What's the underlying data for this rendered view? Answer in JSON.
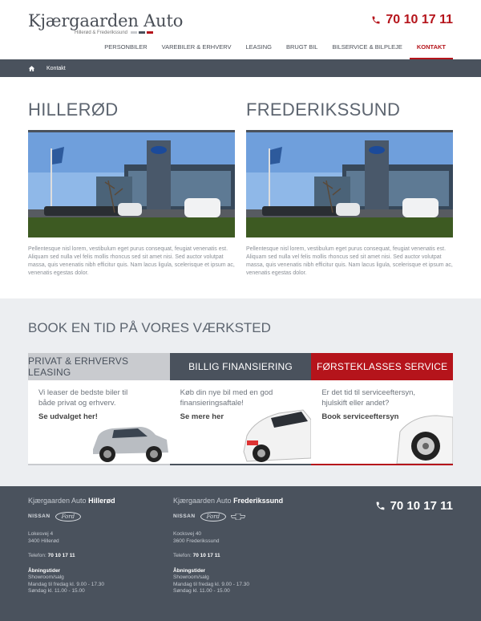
{
  "header": {
    "logo_title": "Kjærgaarden Auto",
    "logo_subtitle": "Hillerød & Frederikssund",
    "phone": "70 10 17 11",
    "nav": [
      {
        "label": "PERSONBILER",
        "active": false
      },
      {
        "label": "VAREBILER & ERHVERV",
        "active": false
      },
      {
        "label": "LEASING",
        "active": false
      },
      {
        "label": "BRUGT BIL",
        "active": false
      },
      {
        "label": "BILSERVICE & BILPLEJE",
        "active": false
      },
      {
        "label": "KONTAKT",
        "active": true
      }
    ]
  },
  "breadcrumb": {
    "current": "Kontakt"
  },
  "locations": [
    {
      "title": "HILLERØD",
      "text": "Pellentesque nisl lorem, vestibulum eget purus consequat, feugiat venenatis est. Aliquam sed nulla vel felis mollis rhoncus sed sit amet nisi. Sed auctor volutpat massa, quis venenatis nibh efficitur quis. Nam lacus ligula, scelerisque et ipsum ac, venenatis egestas dolor."
    },
    {
      "title": "FREDERIKSSUND",
      "text": "Pellentesque nisl lorem, vestibulum eget purus consequat, feugiat venenatis est. Aliquam sed nulla vel felis mollis rhoncus sed sit amet nisi. Sed auctor volutpat massa, quis venenatis nibh efficitur quis. Nam lacus ligula, scelerisque et ipsum ac, venenatis egestas dolor."
    }
  ],
  "booking": {
    "title": "BOOK EN TID PÅ VORES VÆRKSTED",
    "tabs": [
      {
        "label": "PRIVAT & ERHVERVS LEASING",
        "text": "Vi leaser de bedste biler til både privat og erhverv.",
        "link": "Se udvalget her!",
        "head_bg": "#c9cbcf",
        "head_color": "#4a525d"
      },
      {
        "label": "BILLIG FINANSIERING",
        "text": "Køb din nye bil med en god finansieringsaftale!",
        "link": "Se mere her",
        "head_bg": "#4a525d",
        "head_color": "#ffffff"
      },
      {
        "label": "FØRSTEKLASSES SERVICE",
        "text": "Er det tid til serviceeftersyn, hjulskift eller andet?",
        "link": "Book serviceeftersyn",
        "head_bg": "#b5141b",
        "head_color": "#ffffff"
      }
    ]
  },
  "footer": {
    "phone": "70 10 17 11",
    "columns": [
      {
        "title_prefix": "Kjærgaarden Auto",
        "title_city": "Hillerød",
        "brands": [
          "NISSAN",
          "Ford"
        ],
        "address1": "Lokesvej 4",
        "address2": "3400 Hillerød",
        "phone_label": "Telefon:",
        "phone": "70 10 17 11",
        "hours_title": "Åbningstider",
        "hours_sub": "Showroom/salg",
        "hours_weekday": "Mandag til fredag kl. 9.00 - 17.30",
        "hours_sunday": "Søndag kl. 11.00 - 15.00"
      },
      {
        "title_prefix": "Kjærgaarden Auto",
        "title_city": "Frederikssund",
        "brands": [
          "NISSAN",
          "Ford",
          "Chevrolet"
        ],
        "address1": "Kocksvej 40",
        "address2": "3600 Frederikssund",
        "phone_label": "Telefon:",
        "phone": "70 10 17 11",
        "hours_title": "Åbningstider",
        "hours_sub": "Showroom/salg",
        "hours_weekday": "Mandag til fredag kl. 9.00 - 17.30",
        "hours_sunday": "Søndag kl. 11.00 - 15.00"
      }
    ]
  },
  "colors": {
    "accent": "#b5141b",
    "dark": "#4a525d",
    "light_band": "#eceef1"
  }
}
